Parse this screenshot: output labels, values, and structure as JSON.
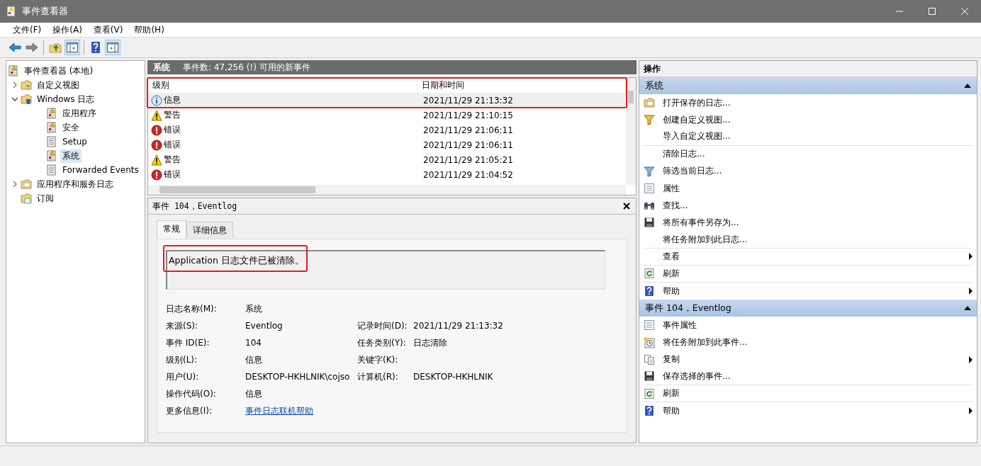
{
  "window": {
    "title": "事件查看器"
  },
  "menu": [
    {
      "label": "文件(F)"
    },
    {
      "label": "操作(A)"
    },
    {
      "label": "查看(V)"
    },
    {
      "label": "帮助(H)"
    }
  ],
  "toolbar": [
    [
      {
        "kind": "back",
        "pressed": false
      },
      {
        "kind": "forward",
        "pressed": false
      }
    ],
    [
      {
        "kind": "up",
        "pressed": false
      },
      {
        "kind": "tree",
        "pressed": true
      }
    ],
    [
      {
        "kind": "help",
        "pressed": false
      },
      {
        "kind": "actions",
        "pressed": true
      }
    ]
  ],
  "tree": [
    {
      "label": "事件查看器 (本地)",
      "kind": "log",
      "selected": false,
      "children": [
        {
          "label": "自定义视图",
          "kind": "filter-folder",
          "expanded": false,
          "selected": false
        },
        {
          "label": "Windows 日志",
          "kind": "windows-folder",
          "expanded": true,
          "selected": false,
          "children": [
            {
              "label": "应用程序",
              "kind": "log",
              "selected": false
            },
            {
              "label": "安全",
              "kind": "log",
              "selected": false
            },
            {
              "label": "Setup",
              "kind": "plain-log",
              "selected": false
            },
            {
              "label": "系统",
              "kind": "log",
              "selected": true
            },
            {
              "label": "Forwarded Events",
              "kind": "plain-log",
              "selected": false
            }
          ]
        },
        {
          "label": "应用程序和服务日志",
          "kind": "folder",
          "expanded": false,
          "selected": false
        },
        {
          "label": "订阅",
          "kind": "subscription",
          "selected": false
        }
      ]
    }
  ],
  "events": {
    "title": "系统",
    "summary": "事件数: 47,256 (!) 可用的新事件",
    "highlighted": true,
    "columns": [
      "级别",
      "日期和时间"
    ],
    "rows": [
      {
        "kind": "info",
        "severity": "信息",
        "time": "2021/11/29 21:13:32",
        "selected": true
      },
      {
        "kind": "warning",
        "severity": "警告",
        "time": "2021/11/29 21:10:15",
        "selected": false
      },
      {
        "kind": "error",
        "severity": "错误",
        "time": "2021/11/29 21:06:11",
        "selected": false
      },
      {
        "kind": "error",
        "severity": "错误",
        "time": "2021/11/29 21:06:11",
        "selected": false
      },
      {
        "kind": "warning",
        "severity": "警告",
        "time": "2021/11/29 21:05:21",
        "selected": false
      },
      {
        "kind": "error",
        "severity": "错误",
        "time": "2021/11/29 21:04:52",
        "selected": false
      }
    ]
  },
  "detail": {
    "title": "事件 104，Eventlog",
    "tabs": [
      {
        "label": "常规",
        "selected": true
      },
      {
        "label": "详细信息",
        "selected": false
      }
    ],
    "message": "Application 日志文件已被清除。",
    "message_highlighted": true,
    "fields": [
      {
        "label": "日志名称(M):",
        "value": "系统"
      },
      {
        "label": "来源(S):",
        "value": "Eventlog",
        "label2": "记录时间(D):",
        "value2": "2021/11/29 21:13:32"
      },
      {
        "label": "事件 ID(E):",
        "value": "104",
        "label2": "任务类别(Y):",
        "value2": "日志清除"
      },
      {
        "label": "级别(L):",
        "value": "信息",
        "label2": "关键字(K):"
      },
      {
        "label": "用户(U):",
        "value": "DESKTOP-HKHLNIK\\cojso",
        "label2": "计算机(R):",
        "value2": "DESKTOP-HKHLNIK"
      },
      {
        "label": "操作代码(O):",
        "value": "信息"
      },
      {
        "label": "更多信息(I):",
        "value": "事件日志联机帮助",
        "kind": "link"
      }
    ]
  },
  "actions": {
    "title": "操作",
    "sections": [
      {
        "title": "系统",
        "expanded": true,
        "items": [
          {
            "label": "打开保存的日志...",
            "kind": "folder",
            "submenu": false,
            "divider": false
          },
          {
            "label": "创建自定义视图...",
            "kind": "funnel-star",
            "submenu": false,
            "divider": false
          },
          {
            "label": "导入自定义视图...",
            "kind": "none",
            "submenu": false,
            "divider": true
          },
          {
            "label": "清除日志...",
            "kind": "none",
            "submenu": false,
            "divider": false
          },
          {
            "label": "筛选当前日志...",
            "kind": "funnel",
            "submenu": false,
            "divider": false
          },
          {
            "label": "属性",
            "kind": "properties",
            "submenu": false,
            "divider": false
          },
          {
            "label": "查找...",
            "kind": "binoculars",
            "submenu": false,
            "divider": false
          },
          {
            "label": "将所有事件另存为...",
            "kind": "save",
            "submenu": false,
            "divider": false
          },
          {
            "label": "将任务附加到此日志...",
            "kind": "none",
            "submenu": false,
            "divider": true
          },
          {
            "label": "查看",
            "kind": "none",
            "submenu": true,
            "divider": true
          },
          {
            "label": "刷新",
            "kind": "refresh",
            "submenu": false,
            "divider": true
          },
          {
            "label": "帮助",
            "kind": "help",
            "submenu": true,
            "divider": false
          }
        ]
      },
      {
        "title": "事件 104，Eventlog",
        "expanded": true,
        "items": [
          {
            "label": "事件属性",
            "kind": "properties",
            "submenu": false,
            "divider": false
          },
          {
            "label": "将任务附加到此事件...",
            "kind": "clock",
            "submenu": false,
            "divider": false
          },
          {
            "label": "复制",
            "kind": "copy",
            "submenu": true,
            "divider": false
          },
          {
            "label": "保存选择的事件...",
            "kind": "save",
            "submenu": false,
            "divider": true
          },
          {
            "label": "刷新",
            "kind": "refresh",
            "submenu": false,
            "divider": true
          },
          {
            "label": "帮助",
            "kind": "help",
            "submenu": true,
            "divider": false
          }
        ]
      }
    ]
  }
}
